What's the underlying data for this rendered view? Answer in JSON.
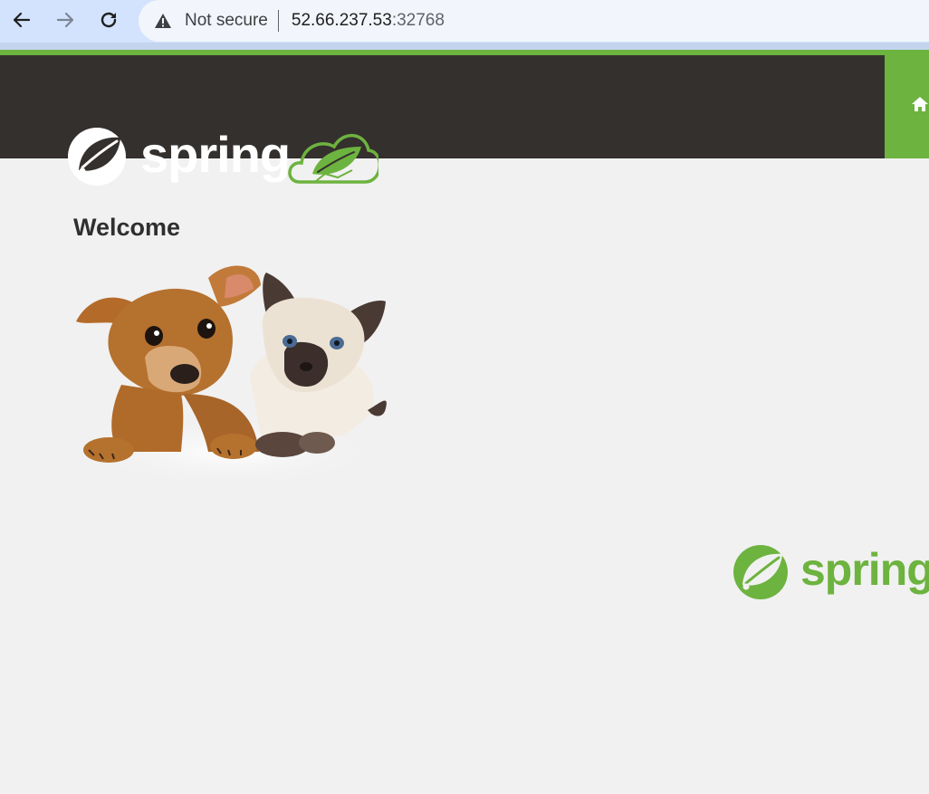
{
  "browser": {
    "security_label": "Not secure",
    "url_host": "52.66.237.53",
    "url_port": ":32768",
    "icons": [
      "back-arrow-icon",
      "forward-arrow-icon",
      "reload-icon",
      "warning-icon"
    ]
  },
  "header": {
    "logo_text": "spring",
    "home_icon": "home-icon"
  },
  "main": {
    "title": "Welcome",
    "image": "pets-illustration"
  },
  "footer": {
    "logo_text": "spring"
  },
  "colors": {
    "brand_green": "#6db33f",
    "header_dark": "#34302d",
    "background": "#f1f1f1"
  }
}
